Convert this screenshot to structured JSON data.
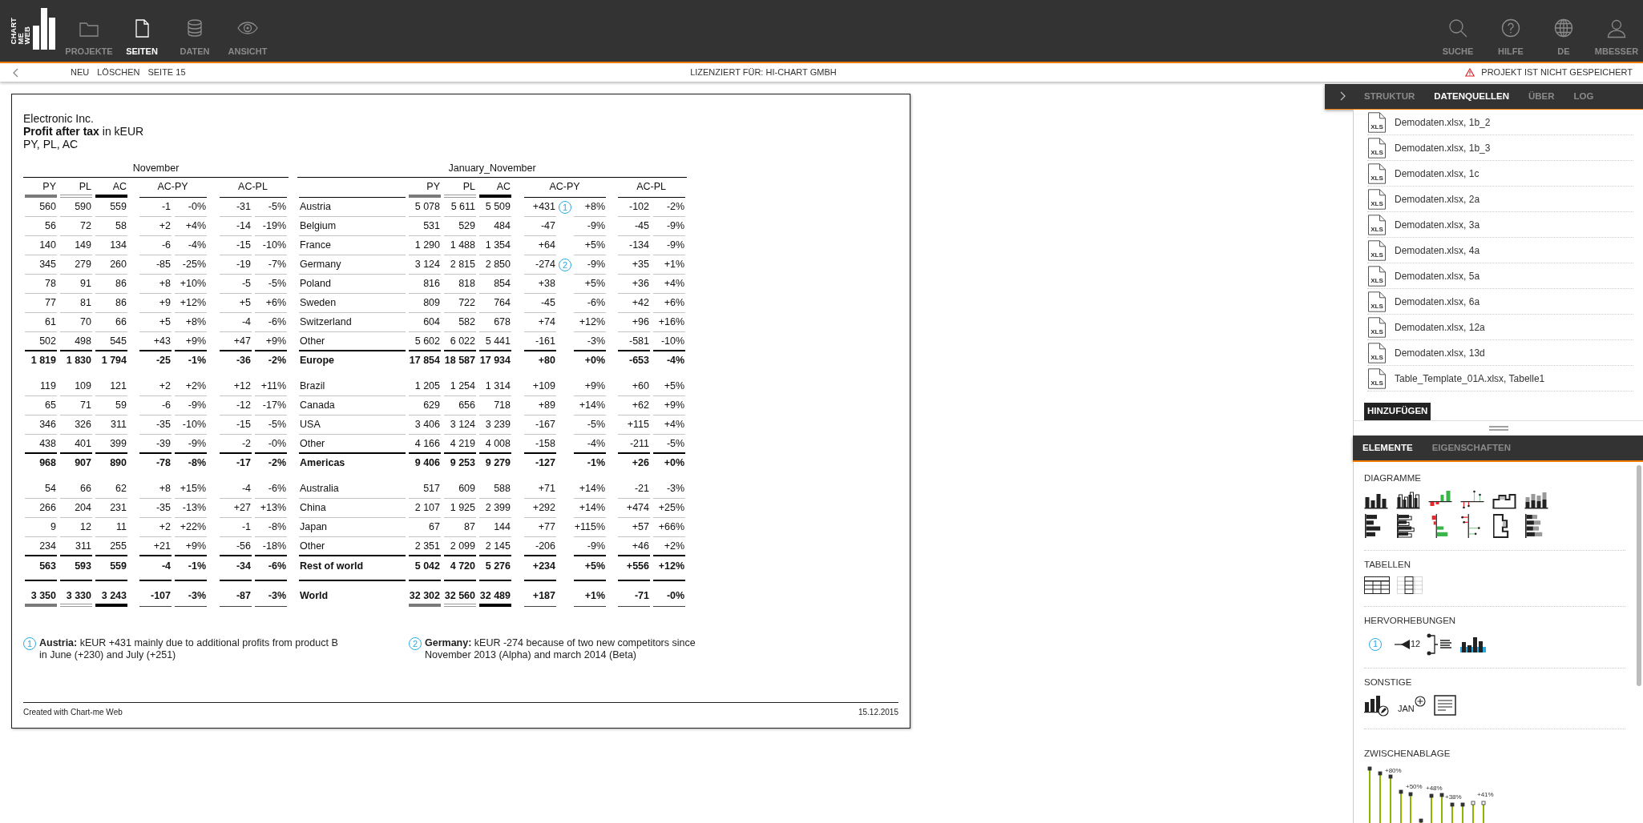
{
  "app": {
    "logo": [
      "CHART",
      "ME",
      "WEB"
    ],
    "nav": [
      {
        "label": "PROJEKTE",
        "selected": false
      },
      {
        "label": "SEITEN",
        "selected": true
      },
      {
        "label": "DATEN",
        "selected": false
      },
      {
        "label": "ANSICHT",
        "selected": false
      }
    ],
    "tools": [
      {
        "label": "SUCHE"
      },
      {
        "label": "HILFE"
      },
      {
        "label": "DE"
      },
      {
        "label": "MBESSER"
      }
    ]
  },
  "toolbar": {
    "actions": [
      "NEU",
      "LÖSCHEN",
      "SEITE 15"
    ],
    "license": "LIZENZIERT FÜR: HI-CHART GMBH",
    "warning": "PROJEKT IST NICHT GESPEICHERT"
  },
  "report": {
    "company": "Electronic Inc.",
    "title": "**Profit after tax** in kEUR",
    "subtitle": "PY, PL, AC",
    "table": {
      "blocks": [
        {
          "period": "November",
          "columns": [
            {
              "label": "PY",
              "kind": "previous"
            },
            {
              "label": "PL",
              "kind": "plan"
            },
            {
              "label": "AC",
              "kind": "actual"
            },
            {
              "label": "AC-PY",
              "kind": "variance"
            },
            {
              "label": "AC-PL",
              "kind": "variance"
            }
          ]
        },
        {
          "period": "January_November",
          "columns": [
            {
              "label": "PY",
              "kind": "previous"
            },
            {
              "label": "PL",
              "kind": "plan"
            },
            {
              "label": "AC",
              "kind": "actual"
            },
            {
              "label": "AC-PY",
              "kind": "variance"
            },
            {
              "label": "AC-PL",
              "kind": "variance"
            }
          ]
        }
      ],
      "rows": [
        {
          "kind": "item",
          "name": "Austria",
          "november": [
            "560",
            "590",
            "559",
            "-1",
            "-0%",
            "-31",
            "-5%"
          ],
          "ytd": [
            "5 078",
            "5 611",
            "5 509",
            "+431",
            "+8%",
            "-102",
            "-2%"
          ],
          "note": "1"
        },
        {
          "kind": "item",
          "name": "Belgium",
          "november": [
            "56",
            "72",
            "58",
            "+2",
            "+4%",
            "-14",
            "-19%"
          ],
          "ytd": [
            "531",
            "529",
            "484",
            "-47",
            "-9%",
            "-45",
            "-9%"
          ]
        },
        {
          "kind": "item",
          "name": "France",
          "november": [
            "140",
            "149",
            "134",
            "-6",
            "-4%",
            "-15",
            "-10%"
          ],
          "ytd": [
            "1 290",
            "1 488",
            "1 354",
            "+64",
            "+5%",
            "-134",
            "-9%"
          ]
        },
        {
          "kind": "item",
          "name": "Germany",
          "november": [
            "345",
            "279",
            "260",
            "-85",
            "-25%",
            "-19",
            "-7%"
          ],
          "ytd": [
            "3 124",
            "2 815",
            "2 850",
            "-274",
            "-9%",
            "+35",
            "+1%"
          ],
          "note": "2"
        },
        {
          "kind": "item",
          "name": "Poland",
          "november": [
            "78",
            "91",
            "86",
            "+8",
            "+10%",
            "-5",
            "-5%"
          ],
          "ytd": [
            "816",
            "818",
            "854",
            "+38",
            "+5%",
            "+36",
            "+4%"
          ]
        },
        {
          "kind": "item",
          "name": "Sweden",
          "november": [
            "77",
            "81",
            "86",
            "+9",
            "+12%",
            "+5",
            "+6%"
          ],
          "ytd": [
            "809",
            "722",
            "764",
            "-45",
            "-6%",
            "+42",
            "+6%"
          ]
        },
        {
          "kind": "item",
          "name": "Switzerland",
          "november": [
            "61",
            "70",
            "66",
            "+5",
            "+8%",
            "-4",
            "-6%"
          ],
          "ytd": [
            "604",
            "582",
            "678",
            "+74",
            "+12%",
            "+96",
            "+16%"
          ]
        },
        {
          "kind": "last",
          "name": "Other",
          "november": [
            "502",
            "498",
            "545",
            "+43",
            "+9%",
            "+47",
            "+9%"
          ],
          "ytd": [
            "5 602",
            "6 022",
            "5 441",
            "-161",
            "-3%",
            "-581",
            "-10%"
          ]
        },
        {
          "kind": "subtotal",
          "name": "Europe",
          "november": [
            "1 819",
            "1 830",
            "1 794",
            "-25",
            "-1%",
            "-36",
            "-2%"
          ],
          "ytd": [
            "17 854",
            "18 587",
            "17 934",
            "+80",
            "+0%",
            "-653",
            "-4%"
          ]
        },
        {
          "kind": "item",
          "name": "Brazil",
          "november": [
            "119",
            "109",
            "121",
            "+2",
            "+2%",
            "+12",
            "+11%"
          ],
          "ytd": [
            "1 205",
            "1 254",
            "1 314",
            "+109",
            "+9%",
            "+60",
            "+5%"
          ]
        },
        {
          "kind": "item",
          "name": "Canada",
          "november": [
            "65",
            "71",
            "59",
            "-6",
            "-9%",
            "-12",
            "-17%"
          ],
          "ytd": [
            "629",
            "656",
            "718",
            "+89",
            "+14%",
            "+62",
            "+9%"
          ]
        },
        {
          "kind": "item",
          "name": "USA",
          "november": [
            "346",
            "326",
            "311",
            "-35",
            "-10%",
            "-15",
            "-5%"
          ],
          "ytd": [
            "3 406",
            "3 124",
            "3 239",
            "-167",
            "-5%",
            "+115",
            "+4%"
          ]
        },
        {
          "kind": "last",
          "name": "Other",
          "november": [
            "438",
            "401",
            "399",
            "-39",
            "-9%",
            "-2",
            "-0%"
          ],
          "ytd": [
            "4 166",
            "4 219",
            "4 008",
            "-158",
            "-4%",
            "-211",
            "-5%"
          ]
        },
        {
          "kind": "subtotal",
          "name": "Americas",
          "november": [
            "968",
            "907",
            "890",
            "-78",
            "-8%",
            "-17",
            "-2%"
          ],
          "ytd": [
            "9 406",
            "9 253",
            "9 279",
            "-127",
            "-1%",
            "+26",
            "+0%"
          ]
        },
        {
          "kind": "item",
          "name": "Australia",
          "november": [
            "54",
            "66",
            "62",
            "+8",
            "+15%",
            "-4",
            "-6%"
          ],
          "ytd": [
            "517",
            "609",
            "588",
            "+71",
            "+14%",
            "-21",
            "-3%"
          ]
        },
        {
          "kind": "item",
          "name": "China",
          "november": [
            "266",
            "204",
            "231",
            "-35",
            "-13%",
            "+27",
            "+13%"
          ],
          "ytd": [
            "2 107",
            "1 925",
            "2 399",
            "+292",
            "+14%",
            "+474",
            "+25%"
          ]
        },
        {
          "kind": "item",
          "name": "Japan",
          "november": [
            "9",
            "12",
            "11",
            "+2",
            "+22%",
            "-1",
            "-8%"
          ],
          "ytd": [
            "67",
            "87",
            "144",
            "+77",
            "+115%",
            "+57",
            "+66%"
          ]
        },
        {
          "kind": "last",
          "name": "Other",
          "november": [
            "234",
            "311",
            "255",
            "+21",
            "+9%",
            "-56",
            "-18%"
          ],
          "ytd": [
            "2 351",
            "2 099",
            "2 145",
            "-206",
            "-9%",
            "+46",
            "+2%"
          ]
        },
        {
          "kind": "closing",
          "name": "Rest of world",
          "november": [
            "563",
            "593",
            "559",
            "-4",
            "-1%",
            "-34",
            "-6%"
          ],
          "ytd": [
            "5 042",
            "4 720",
            "5 276",
            "+234",
            "+5%",
            "+556",
            "+12%"
          ]
        },
        {
          "kind": "total",
          "name": "World",
          "november": [
            "3 350",
            "3 330",
            "3 243",
            "-107",
            "-3%",
            "-87",
            "-3%"
          ],
          "ytd": [
            "32 302",
            "32 560",
            "32 489",
            "+187",
            "+1%",
            "-71",
            "-0%"
          ]
        }
      ]
    },
    "footnotes": [
      {
        "marker": "1",
        "text": "**Austria:** kEUR +431 mainly due to additional profits from product B in June (+230) and July (+251)"
      },
      {
        "marker": "2",
        "text": "**Germany:** kEUR -274 because of two new competitors since November 2013 (Alpha) and march 2014 (Beta)"
      }
    ],
    "footer": {
      "credit": "Created with Chart-me Web",
      "date": "15.12.2015"
    }
  },
  "datasource_panel": {
    "tabs": [
      {
        "label": "STRUKTUR",
        "selected": false
      },
      {
        "label": "DATENQUELLEN",
        "selected": true
      },
      {
        "label": "ÜBER",
        "selected": false
      },
      {
        "label": "LOG",
        "selected": false
      }
    ],
    "files": [
      {
        "name": "Demodaten.xlsx, 1b_2",
        "type": "XLS"
      },
      {
        "name": "Demodaten.xlsx, 1b_3",
        "type": "XLS"
      },
      {
        "name": "Demodaten.xlsx, 1c",
        "type": "XLS"
      },
      {
        "name": "Demodaten.xlsx, 2a",
        "type": "XLS"
      },
      {
        "name": "Demodaten.xlsx, 3a",
        "type": "XLS"
      },
      {
        "name": "Demodaten.xlsx, 4a",
        "type": "XLS"
      },
      {
        "name": "Demodaten.xlsx, 5a",
        "type": "XLS"
      },
      {
        "name": "Demodaten.xlsx, 6a",
        "type": "XLS"
      },
      {
        "name": "Demodaten.xlsx, 12a",
        "type": "XLS"
      },
      {
        "name": "Demodaten.xlsx, 13d",
        "type": "XLS"
      },
      {
        "name": "Table_Template_01A.xlsx, Tabelle1",
        "type": "XLS"
      }
    ],
    "add_button": "HINZUFÜGEN"
  },
  "elements_panel": {
    "tabs": [
      {
        "label": "ELEMENTE",
        "selected": true
      },
      {
        "label": "EIGENSCHAFTEN",
        "selected": false
      }
    ],
    "sections": [
      {
        "kind": "charts",
        "title": "DIAGRAMME"
      },
      {
        "kind": "tables",
        "title": "TABELLEN"
      },
      {
        "kind": "highlights",
        "title": "HERVORHEBUNGEN",
        "marker": "1",
        "label": "12"
      },
      {
        "kind": "misc",
        "title": "SONSTIGE",
        "label": "JAN"
      }
    ],
    "clipboard": {
      "title": "ZWISCHENABLAGE",
      "labels": [
        "+80%",
        "+50%",
        "+48%",
        "+38%",
        "+41%"
      ]
    }
  }
}
